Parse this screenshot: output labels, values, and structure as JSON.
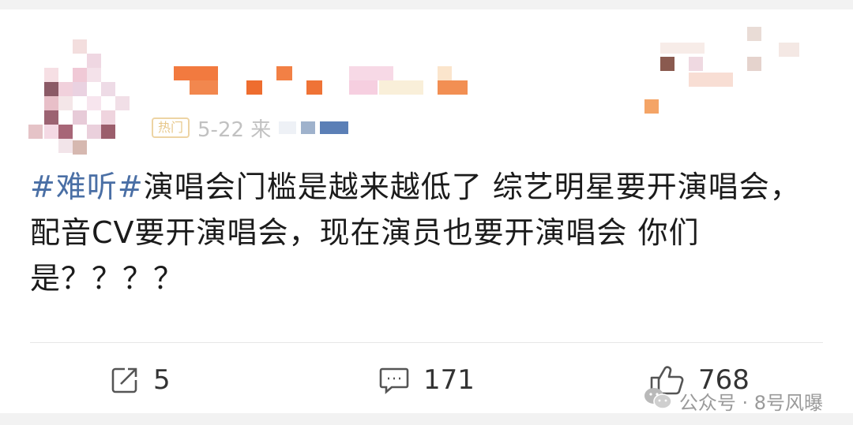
{
  "post": {
    "hashtag": "#难听#",
    "body": "演唱会门槛是越来越低了 综艺明星要开演唱会，配音CV要开演唱会，现在演员也要开演唱会 你们是？？？？",
    "meta_date": "5-22 来"
  },
  "badges": {
    "hot": "热门"
  },
  "actions": {
    "repost_count": "5",
    "comment_count": "171",
    "like_count": "768"
  },
  "icons": {
    "repost": "share-icon",
    "comment": "comment-icon",
    "like": "thumbs-up-icon",
    "wechat": "wechat-icon"
  },
  "watermark": {
    "text": "公众号 · 8号风曝"
  },
  "colors": {
    "hashtag": "#4a6fa5",
    "text": "#1b1b1b",
    "muted": "#9a9a9a"
  }
}
